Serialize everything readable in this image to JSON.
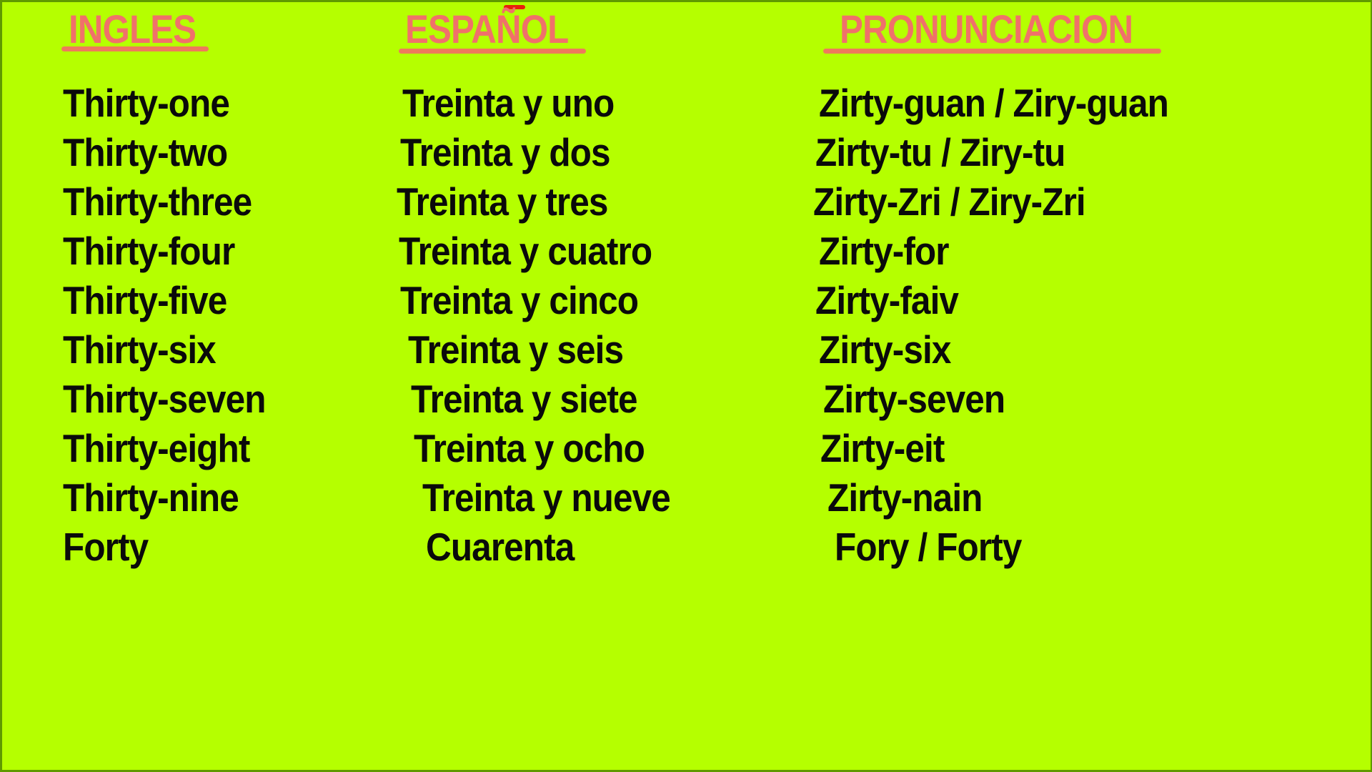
{
  "headers": {
    "english": "INGLES",
    "spanish": "ESPAÑOL",
    "pronunciation": "PRONUNCIACION"
  },
  "colors": {
    "background": "#b5ff00",
    "header": "#f0716a",
    "underline": "#ee7a5c",
    "text": "#0a0a0a"
  },
  "rows": [
    {
      "english": "Thirty-one",
      "spanish": "Treinta y uno",
      "pronunciation": "Zirty-guan / Ziry-guan"
    },
    {
      "english": "Thirty-two",
      "spanish": "Treinta y dos",
      "pronunciation": "Zirty-tu / Ziry-tu"
    },
    {
      "english": "Thirty-three",
      "spanish": "Treinta y tres",
      "pronunciation": "Zirty-Zri / Ziry-Zri"
    },
    {
      "english": "Thirty-four",
      "spanish": "Treinta y cuatro",
      "pronunciation": "Zirty-for"
    },
    {
      "english": "Thirty-five",
      "spanish": "Treinta y cinco",
      "pronunciation": "Zirty-faiv"
    },
    {
      "english": "Thirty-six",
      "spanish": "Treinta y seis",
      "pronunciation": "Zirty-six"
    },
    {
      "english": "Thirty-seven",
      "spanish": "Treinta y siete",
      "pronunciation": "Zirty-seven"
    },
    {
      "english": "Thirty-eight",
      "spanish": "Treinta y ocho",
      "pronunciation": "Zirty-eit"
    },
    {
      "english": "Thirty-nine",
      "spanish": "Treinta y nueve",
      "pronunciation": "Zirty-nain"
    },
    {
      "english": "Forty",
      "spanish": "Cuarenta",
      "pronunciation": "Fory / Forty"
    }
  ]
}
